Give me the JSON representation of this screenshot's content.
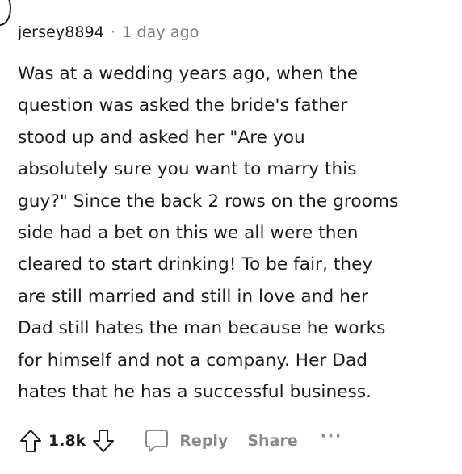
{
  "comment": {
    "username": "jersey8894",
    "separator": "·",
    "timestamp": "1 day ago",
    "body_lines": [
      "Was at a wedding years ago, when the",
      "question was asked the bride's father",
      "stood up and asked her \"Are you",
      "absolutely sure you want to marry this",
      "guy?\" Since the back 2 rows on the grooms",
      "side had a bet on this we all were then",
      "cleared to start drinking! To be fair, they",
      "are still married and still in love and her",
      "Dad still hates the man because he works",
      "for himself and not a company. Her Dad",
      "hates that he has a successful business."
    ]
  },
  "actions": {
    "upvote_icon": "arrow-up-outline-icon",
    "score": "1.8k",
    "downvote_icon": "arrow-down-outline-icon",
    "reply_icon": "speech-bubble-icon",
    "reply_label": "Reply",
    "share_label": "Share",
    "more_label": "···"
  },
  "colors": {
    "text_primary": "#1c1c1c",
    "text_muted": "#878a8c",
    "background": "#ffffff"
  }
}
